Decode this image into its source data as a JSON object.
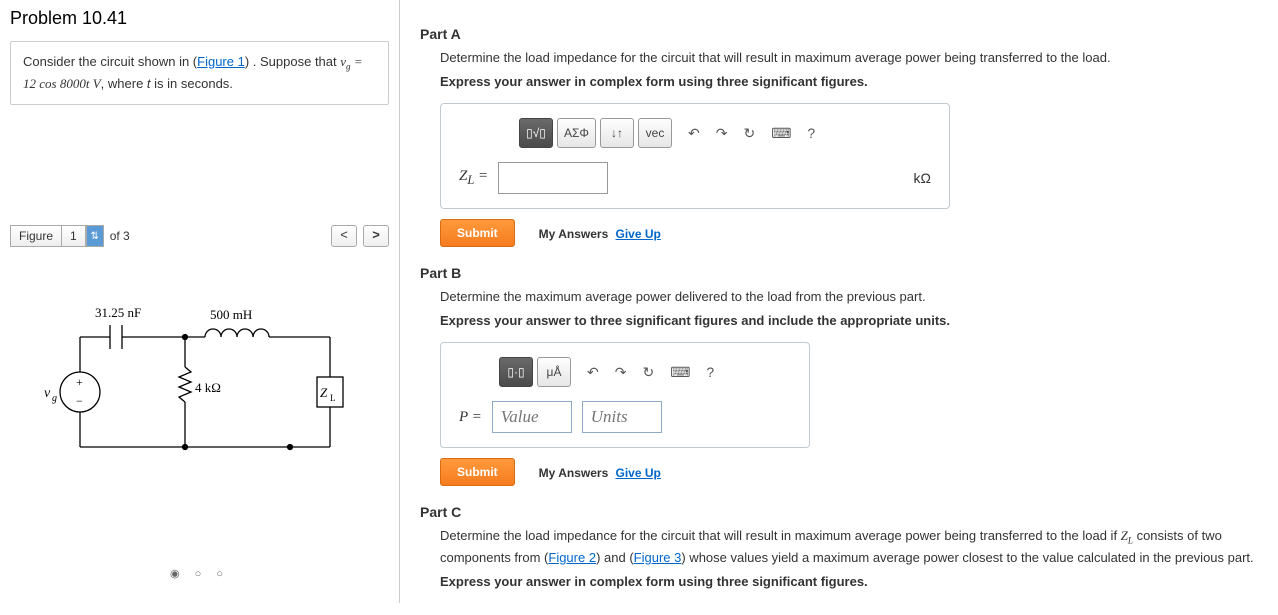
{
  "problem": {
    "title": "Problem 10.41",
    "description_prefix": "Consider the circuit shown in (",
    "figure_link": "Figure 1",
    "description_mid": ") . Suppose that ",
    "vg_expr": "v_g = 12 cos 8000t V",
    "description_suffix": ", where t is in seconds."
  },
  "figure_panel": {
    "label": "Figure",
    "selected": "1",
    "total": "of 3"
  },
  "circuit": {
    "c_label": "31.25 nF",
    "l_label": "500 mH",
    "r_label": "4 kΩ",
    "vg_label": "v_g",
    "zl_label": "Z_L"
  },
  "toolbar": {
    "math_templates": "▯√▯",
    "greek": "ΑΣΦ",
    "subscript": "↓↑",
    "vec": "vec",
    "undo": "↶",
    "redo": "↷",
    "reset": "↻",
    "keyboard": "⌨",
    "help": "?",
    "units_palette": "▯·▯",
    "micro_angstrom": "μÅ"
  },
  "partA": {
    "title": "Part A",
    "prompt": "Determine the load impedance for the circuit that will result in maximum average power being transferred to the load.",
    "instruction": "Express your answer in complex form using three significant figures.",
    "var_label": "Z_L =",
    "unit": "kΩ"
  },
  "partB": {
    "title": "Part B",
    "prompt": "Determine the maximum average power delivered to the load from the previous part.",
    "instruction": "Express your answer to three significant figures and include the appropriate units.",
    "var_label": "P =",
    "value_placeholder": "Value",
    "units_placeholder": "Units"
  },
  "partC": {
    "title": "Part C",
    "prompt_prefix": "Determine the load impedance for the circuit that will result in maximum average power being transferred to the load if ",
    "zl_var": "Z_L",
    "prompt_mid": " consists of two components from (",
    "fig2": "Figure 2",
    "prompt_and": ") and (",
    "fig3": "Figure 3",
    "prompt_suffix": ") whose values yield a maximum average power closest to the value calculated in the previous part.",
    "instruction": "Express your answer in complex form using three significant figures."
  },
  "actions": {
    "submit": "Submit",
    "my_answers": "My Answers",
    "give_up": "Give Up"
  }
}
